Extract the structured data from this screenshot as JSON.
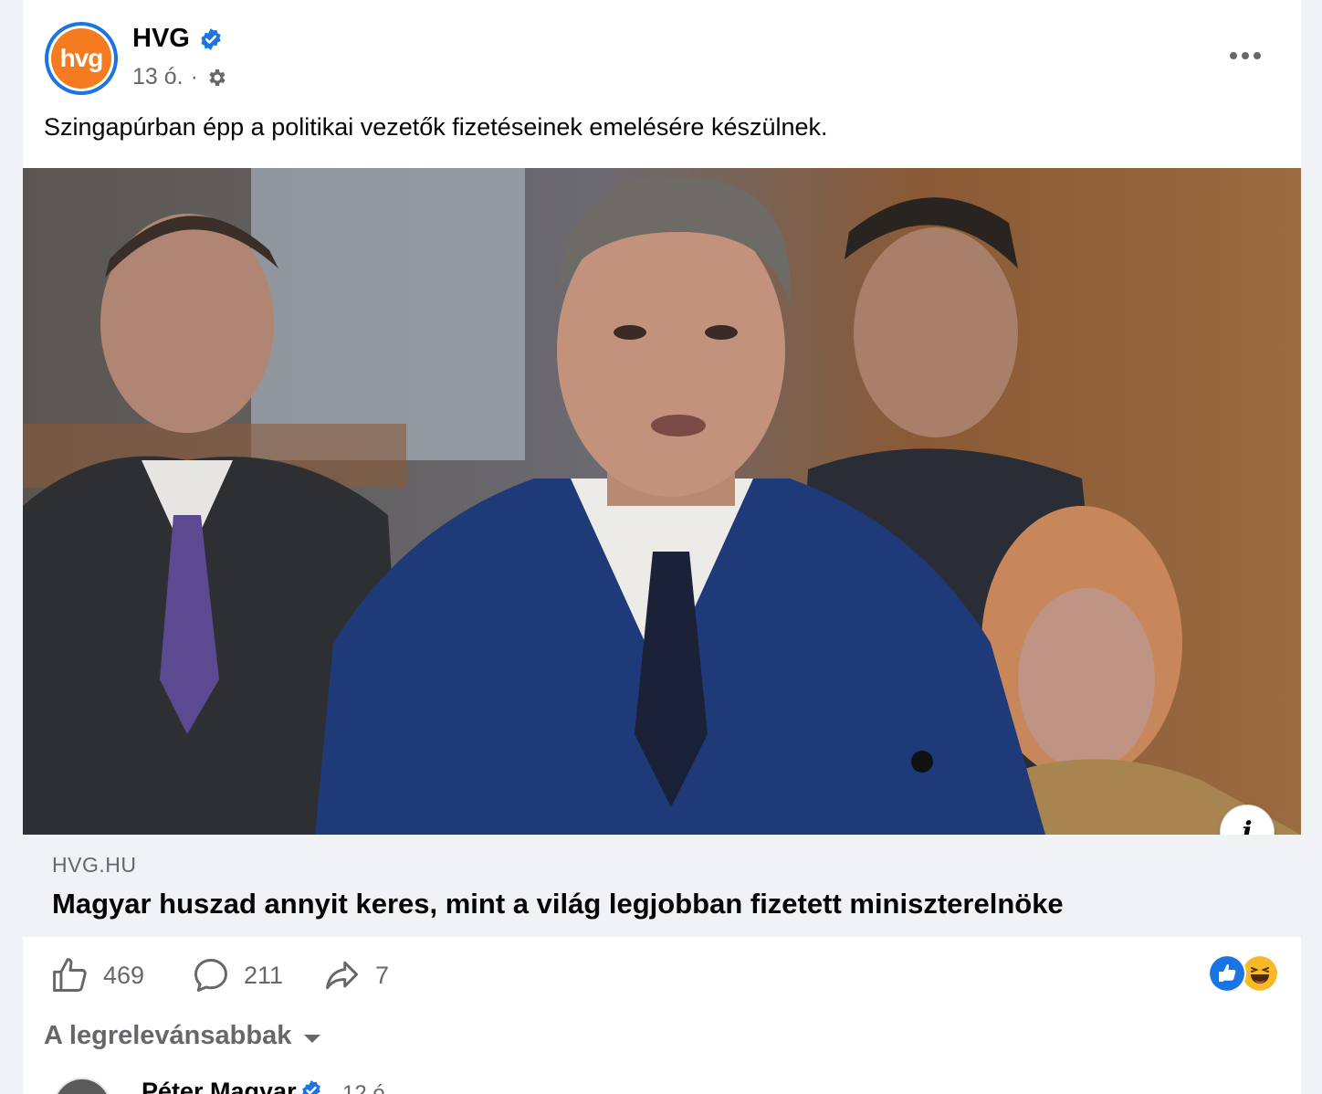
{
  "post": {
    "page_name": "HVG",
    "avatar_text": "hvg",
    "time": "13 ó.",
    "separator": "·",
    "text": "Szingapúrban épp a politikai vezetők fizetéseinek emelésére készülnek."
  },
  "link": {
    "domain": "HVG.HU",
    "title": "Magyar huszad annyit keres, mint a világ legjobban fizetett miniszterelnöke",
    "info_glyph": "i"
  },
  "actions": {
    "likes": "469",
    "comments": "211",
    "shares": "7"
  },
  "reactions": [
    "like-icon",
    "haha-icon"
  ],
  "comments_section": {
    "sort_label": "A legrelevánsabbak",
    "first_comment": {
      "author": "Péter Magyar",
      "time": "12 ó."
    }
  },
  "colors": {
    "accent": "#1b74e4",
    "hvg_orange": "#f47b20",
    "secondary_text": "#65676b",
    "link_bg": "#f0f2f5"
  }
}
